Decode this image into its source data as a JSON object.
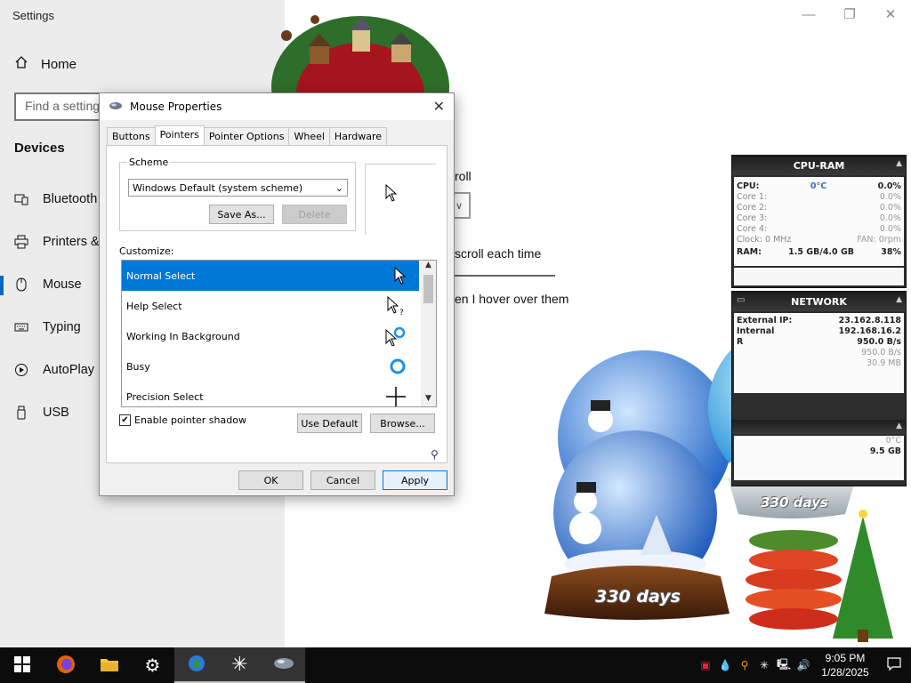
{
  "settings": {
    "title": "Settings",
    "controls": {
      "minimize": "—",
      "maximize": "❐",
      "close": "✕"
    },
    "home_label": "Home",
    "search_placeholder": "Find a setting",
    "section_header": "Devices",
    "nav": [
      {
        "label": "Bluetooth",
        "icon": "bluetooth-icon"
      },
      {
        "label": "Printers &",
        "icon": "printer-icon"
      },
      {
        "label": "Mouse",
        "icon": "mouse-icon",
        "active": true
      },
      {
        "label": "Typing",
        "icon": "keyboard-icon"
      },
      {
        "label": "AutoPlay",
        "icon": "autoplay-icon"
      },
      {
        "label": "USB",
        "icon": "usb-icon"
      }
    ],
    "content": {
      "scroll_label": "roll",
      "scroll_each": "scroll each time",
      "hover_label": "en I hover over them"
    }
  },
  "dialog": {
    "title": "Mouse Properties",
    "tabs": [
      "Buttons",
      "Pointers",
      "Pointer Options",
      "Wheel",
      "Hardware"
    ],
    "active_tab": "Pointers",
    "scheme_label": "Scheme",
    "scheme_value": "Windows Default (system scheme)",
    "save_as": "Save As...",
    "delete": "Delete",
    "customize_label": "Customize:",
    "cursors": [
      {
        "label": "Normal Select",
        "icon": "arrow-cursor-icon",
        "selected": true
      },
      {
        "label": "Help Select",
        "icon": "help-cursor-icon"
      },
      {
        "label": "Working In Background",
        "icon": "working-cursor-icon"
      },
      {
        "label": "Busy",
        "icon": "busy-cursor-icon"
      },
      {
        "label": "Precision Select",
        "icon": "crosshair-cursor-icon"
      }
    ],
    "shadow_label": "Enable pointer shadow",
    "shadow_checked": true,
    "use_default": "Use Default",
    "browse": "Browse...",
    "ok": "OK",
    "cancel": "Cancel",
    "apply": "Apply"
  },
  "cpu_gadget": {
    "title": "CPU-RAM",
    "rows": [
      {
        "k": "CPU:",
        "mid": "0°C",
        "v": "0.0%",
        "bold": true
      },
      {
        "k": "Core 1:",
        "v": "0.0%"
      },
      {
        "k": "Core 2:",
        "v": "0.0%"
      },
      {
        "k": "Core 3:",
        "v": "0.0%"
      },
      {
        "k": "Core 4:",
        "v": "0.0%"
      },
      {
        "k": "Clock: 0 MHz",
        "v": "FAN: 0rpm"
      }
    ],
    "ram": {
      "k": "RAM:",
      "mid": "1.5 GB/4.0 GB",
      "v": "38%"
    }
  },
  "net_gadget": {
    "title": "NETWORK",
    "rows": [
      {
        "k": "External IP:",
        "v": "23.162.8.118"
      },
      {
        "k": "Internal",
        "v": "192.168.16.2"
      },
      {
        "k": "R",
        "v": "950.0 B/s"
      },
      {
        "k": "",
        "v": "950.0 B/s"
      },
      {
        "k": "",
        "v": "30.9 MB"
      }
    ],
    "temp": "0°C",
    "size": "9.5 GB"
  },
  "globes": {
    "days_label": "330 days"
  },
  "taskbar": {
    "time": "9:05 PM",
    "date": "1/28/2025",
    "tray_icons": [
      "network-icon",
      "volume-icon"
    ]
  },
  "colors": {
    "accent": "#0078d7",
    "sidebar": "#ececec",
    "taskbar": "#0c0c0c"
  }
}
